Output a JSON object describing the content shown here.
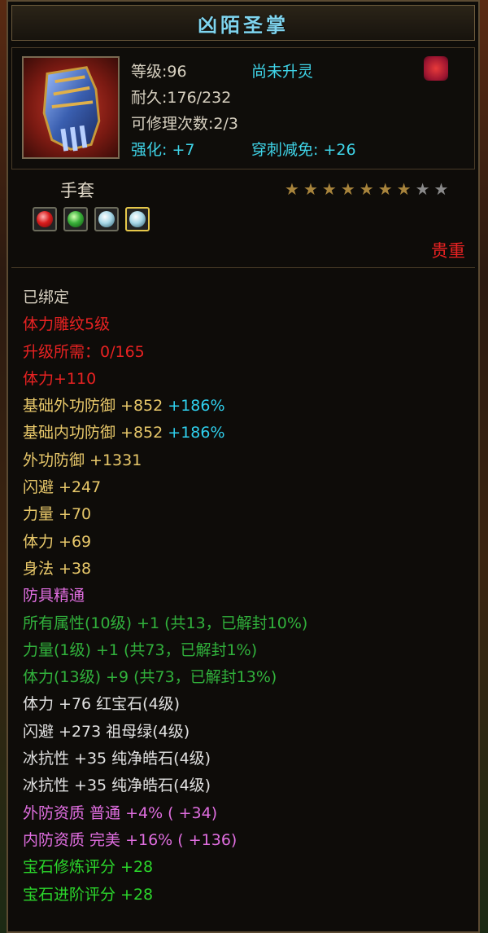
{
  "item": {
    "name": "凶陌圣掌",
    "level": "等级:96",
    "spirit_status": "尚未升灵",
    "durability": "耐久:176/232",
    "repair": "可修理次数:2/3",
    "enhance": "强化: +7",
    "pierce": "穿刺减免: +26",
    "type": "手套",
    "rarity": "贵重",
    "stars": {
      "filled": 7,
      "total": 9
    },
    "sockets": [
      "ruby-icon",
      "emerald-icon",
      "pure-gem-icon",
      "pure-gem-icon"
    ]
  },
  "attributes": [
    {
      "text": "已绑定",
      "color": "#d7d0c0"
    },
    {
      "text": "体力雕纹5级",
      "color": "#e82222"
    },
    {
      "text": "升级所需：0/165",
      "color": "#e82222"
    },
    {
      "text": "体力+110",
      "color": "#e82222"
    },
    {
      "text": "基础外功防御 +852",
      "extra": "+186%",
      "color": "#e8c86a"
    },
    {
      "text": "基础内功防御 +852",
      "extra": "+186%",
      "color": "#e8c86a"
    },
    {
      "text": "外功防御 +1331",
      "color": "#e8c86a"
    },
    {
      "text": "闪避 +247",
      "color": "#e8c86a"
    },
    {
      "text": "力量 +70",
      "color": "#e8c86a"
    },
    {
      "text": "体力 +69",
      "color": "#e8c86a"
    },
    {
      "text": "身法 +38",
      "color": "#e8c86a"
    },
    {
      "text": "防具精通",
      "color": "#e06ee0"
    },
    {
      "text": "所有属性(10级) +1 (共13，已解封10%)",
      "color": "#31b23c"
    },
    {
      "text": "力量(1级) +1 (共73，已解封1%)",
      "color": "#31b23c"
    },
    {
      "text": "体力(13级) +9 (共73，已解封13%)",
      "color": "#31b23c"
    },
    {
      "text": "体力 +76 红宝石(4级)",
      "color": "#e0e0e0",
      "gem": true
    },
    {
      "text": "闪避 +273 祖母绿(4级)",
      "color": "#e0e0e0",
      "gem": true
    },
    {
      "text": "冰抗性 +35 纯净皓石(4级)",
      "color": "#e0e0e0",
      "gem": true
    },
    {
      "text": "冰抗性 +35 纯净皓石(4级)",
      "color": "#e0e0e0",
      "gem": true
    },
    {
      "text": "外防资质 普通 +4% ( +34)",
      "color": "#e06ee0"
    },
    {
      "text": "内防资质 完美 +16% ( +136)",
      "color": "#e06ee0"
    },
    {
      "text": "宝石修炼评分 +28",
      "color": "#2bd62b"
    },
    {
      "text": "宝石进阶评分 +28",
      "color": "#2bd62b"
    }
  ]
}
